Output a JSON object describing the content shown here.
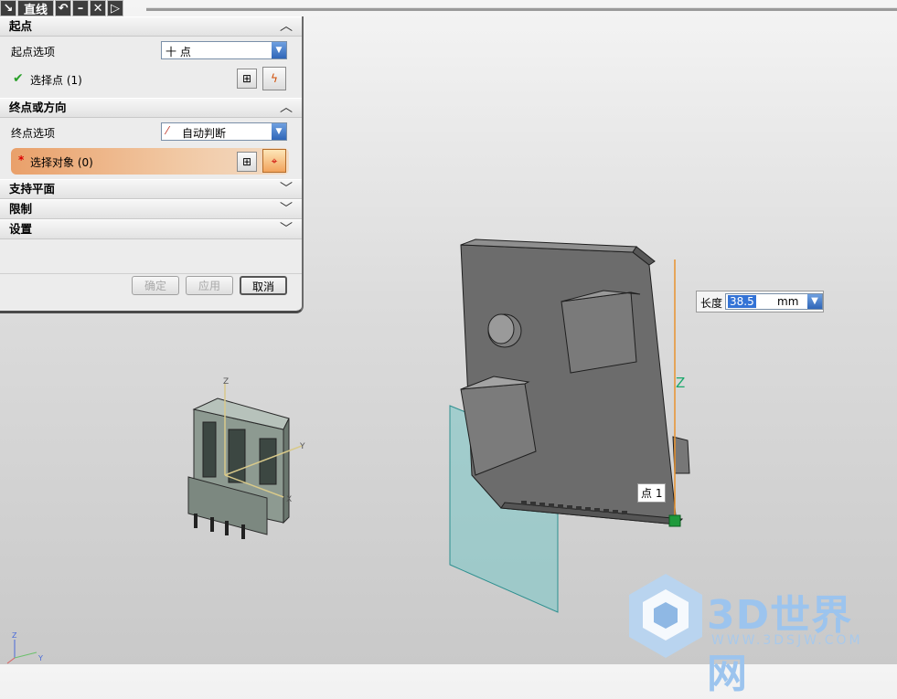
{
  "window": {
    "title": "直线"
  },
  "toolbar": {
    "undo_glyph": "↶",
    "minimize_glyph": "–",
    "close_glyph": "✕",
    "more_glyph": "▷",
    "tool_glyph": "↘"
  },
  "dialog": {
    "start_section": {
      "title": "起点",
      "option_label": "起点选项",
      "option_value": "十 点",
      "select_label": "选择点 (1)",
      "check_glyph": "✔"
    },
    "end_section": {
      "title": "终点或方向",
      "option_label": "终点选项",
      "option_value": "自动判断",
      "select_label": "选择对象 (0)",
      "required_glyph": "*"
    },
    "collapsed_sections": [
      "支持平面",
      "限制",
      "设置"
    ],
    "buttons": {
      "ok": "确定",
      "apply": "应用",
      "cancel": "取消"
    },
    "collapse_glyph": "︿",
    "expand_glyph": "﹀"
  },
  "length_input": {
    "label": "长度",
    "value": "38.5",
    "unit": "mm"
  },
  "viewport": {
    "point_tag": "点 1",
    "axis_z": "Z",
    "small_axes": {
      "z": "Z",
      "x": "X",
      "y": "Y"
    },
    "triad": {
      "z": "Z",
      "x": "X",
      "y": "Y"
    }
  },
  "watermark": {
    "brand": "3D世界网",
    "url": "WWW.3DSJW.COM"
  },
  "colors": {
    "accent": "#f08a3c",
    "plane": "#7fc6c6",
    "line": "#e8922e",
    "axis_label": "#1aa86b",
    "watermark": "#9cc4ee"
  }
}
